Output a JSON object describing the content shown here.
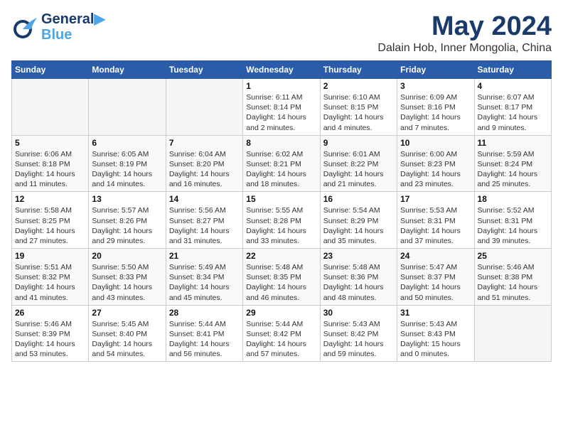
{
  "header": {
    "logo_line1": "General",
    "logo_line2": "Blue",
    "month": "May 2024",
    "location": "Dalain Hob, Inner Mongolia, China"
  },
  "weekdays": [
    "Sunday",
    "Monday",
    "Tuesday",
    "Wednesday",
    "Thursday",
    "Friday",
    "Saturday"
  ],
  "weeks": [
    [
      {
        "day": "",
        "info": ""
      },
      {
        "day": "",
        "info": ""
      },
      {
        "day": "",
        "info": ""
      },
      {
        "day": "1",
        "info": "Sunrise: 6:11 AM\nSunset: 8:14 PM\nDaylight: 14 hours\nand 2 minutes."
      },
      {
        "day": "2",
        "info": "Sunrise: 6:10 AM\nSunset: 8:15 PM\nDaylight: 14 hours\nand 4 minutes."
      },
      {
        "day": "3",
        "info": "Sunrise: 6:09 AM\nSunset: 8:16 PM\nDaylight: 14 hours\nand 7 minutes."
      },
      {
        "day": "4",
        "info": "Sunrise: 6:07 AM\nSunset: 8:17 PM\nDaylight: 14 hours\nand 9 minutes."
      }
    ],
    [
      {
        "day": "5",
        "info": "Sunrise: 6:06 AM\nSunset: 8:18 PM\nDaylight: 14 hours\nand 11 minutes."
      },
      {
        "day": "6",
        "info": "Sunrise: 6:05 AM\nSunset: 8:19 PM\nDaylight: 14 hours\nand 14 minutes."
      },
      {
        "day": "7",
        "info": "Sunrise: 6:04 AM\nSunset: 8:20 PM\nDaylight: 14 hours\nand 16 minutes."
      },
      {
        "day": "8",
        "info": "Sunrise: 6:02 AM\nSunset: 8:21 PM\nDaylight: 14 hours\nand 18 minutes."
      },
      {
        "day": "9",
        "info": "Sunrise: 6:01 AM\nSunset: 8:22 PM\nDaylight: 14 hours\nand 21 minutes."
      },
      {
        "day": "10",
        "info": "Sunrise: 6:00 AM\nSunset: 8:23 PM\nDaylight: 14 hours\nand 23 minutes."
      },
      {
        "day": "11",
        "info": "Sunrise: 5:59 AM\nSunset: 8:24 PM\nDaylight: 14 hours\nand 25 minutes."
      }
    ],
    [
      {
        "day": "12",
        "info": "Sunrise: 5:58 AM\nSunset: 8:25 PM\nDaylight: 14 hours\nand 27 minutes."
      },
      {
        "day": "13",
        "info": "Sunrise: 5:57 AM\nSunset: 8:26 PM\nDaylight: 14 hours\nand 29 minutes."
      },
      {
        "day": "14",
        "info": "Sunrise: 5:56 AM\nSunset: 8:27 PM\nDaylight: 14 hours\nand 31 minutes."
      },
      {
        "day": "15",
        "info": "Sunrise: 5:55 AM\nSunset: 8:28 PM\nDaylight: 14 hours\nand 33 minutes."
      },
      {
        "day": "16",
        "info": "Sunrise: 5:54 AM\nSunset: 8:29 PM\nDaylight: 14 hours\nand 35 minutes."
      },
      {
        "day": "17",
        "info": "Sunrise: 5:53 AM\nSunset: 8:31 PM\nDaylight: 14 hours\nand 37 minutes."
      },
      {
        "day": "18",
        "info": "Sunrise: 5:52 AM\nSunset: 8:31 PM\nDaylight: 14 hours\nand 39 minutes."
      }
    ],
    [
      {
        "day": "19",
        "info": "Sunrise: 5:51 AM\nSunset: 8:32 PM\nDaylight: 14 hours\nand 41 minutes."
      },
      {
        "day": "20",
        "info": "Sunrise: 5:50 AM\nSunset: 8:33 PM\nDaylight: 14 hours\nand 43 minutes."
      },
      {
        "day": "21",
        "info": "Sunrise: 5:49 AM\nSunset: 8:34 PM\nDaylight: 14 hours\nand 45 minutes."
      },
      {
        "day": "22",
        "info": "Sunrise: 5:48 AM\nSunset: 8:35 PM\nDaylight: 14 hours\nand 46 minutes."
      },
      {
        "day": "23",
        "info": "Sunrise: 5:48 AM\nSunset: 8:36 PM\nDaylight: 14 hours\nand 48 minutes."
      },
      {
        "day": "24",
        "info": "Sunrise: 5:47 AM\nSunset: 8:37 PM\nDaylight: 14 hours\nand 50 minutes."
      },
      {
        "day": "25",
        "info": "Sunrise: 5:46 AM\nSunset: 8:38 PM\nDaylight: 14 hours\nand 51 minutes."
      }
    ],
    [
      {
        "day": "26",
        "info": "Sunrise: 5:46 AM\nSunset: 8:39 PM\nDaylight: 14 hours\nand 53 minutes."
      },
      {
        "day": "27",
        "info": "Sunrise: 5:45 AM\nSunset: 8:40 PM\nDaylight: 14 hours\nand 54 minutes."
      },
      {
        "day": "28",
        "info": "Sunrise: 5:44 AM\nSunset: 8:41 PM\nDaylight: 14 hours\nand 56 minutes."
      },
      {
        "day": "29",
        "info": "Sunrise: 5:44 AM\nSunset: 8:42 PM\nDaylight: 14 hours\nand 57 minutes."
      },
      {
        "day": "30",
        "info": "Sunrise: 5:43 AM\nSunset: 8:42 PM\nDaylight: 14 hours\nand 59 minutes."
      },
      {
        "day": "31",
        "info": "Sunrise: 5:43 AM\nSunset: 8:43 PM\nDaylight: 15 hours\nand 0 minutes."
      },
      {
        "day": "",
        "info": ""
      }
    ]
  ]
}
